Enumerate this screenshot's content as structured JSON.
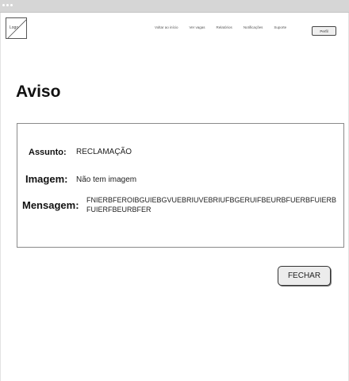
{
  "logo": {
    "label": "Logo"
  },
  "nav": {
    "items": [
      "Voltar ao início",
      "Ver vagas",
      "Relatórios",
      "Notificações",
      "Suporte"
    ]
  },
  "header": {
    "profile_label": "Perfil"
  },
  "page": {
    "title": "Aviso"
  },
  "notice": {
    "subject_label": "Assunto:",
    "subject_value": "RECLAMAÇÃO",
    "image_label": "Imagem:",
    "image_value": "Não tem imagem",
    "message_label": "Mensagem:",
    "message_value": "FNIERBFEROIBGUIEBGVUEBRIUVEBRIUFBGERUIFBEURBFUERBFUIERBFUIERFBEURBFER"
  },
  "actions": {
    "close_label": "FECHAR"
  }
}
